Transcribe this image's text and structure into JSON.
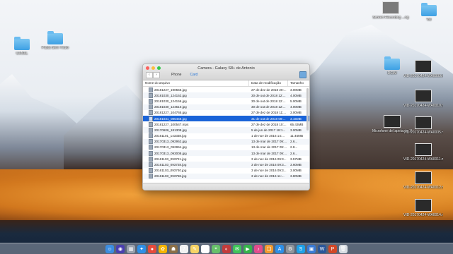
{
  "window": {
    "title": "Camera - Galaxy S8+ de Antonio",
    "nav_back": "‹",
    "nav_forward": "›",
    "tab_phone": "Phone",
    "tab_card": "Card",
    "columns": {
      "name": "Nome do arquivo",
      "date": "Data de modificação",
      "size": "Tamanho"
    },
    "rows": [
      {
        "name": "20181227_190556.jpg",
        "date": "27 de dez de 2018 20:...",
        "size": "3.00MB",
        "selected": false
      },
      {
        "name": "20181030_124152.jpg",
        "date": "30 de out de 2018 12:...",
        "size": "4.00MB",
        "selected": false
      },
      {
        "name": "20181030_124156.jpg",
        "date": "30 de out de 2018 12:...",
        "size": "5.00MB",
        "selected": false
      },
      {
        "name": "20181030_124510.jpg",
        "date": "30 de out de 2018 12:...",
        "size": "4.00MB",
        "selected": false
      },
      {
        "name": "20181227_104765.jpg",
        "date": "27 de dez de 2018 11:...",
        "size": "3.00MB",
        "selected": false
      },
      {
        "name": "20181031_085458.jpg",
        "date": "31 de out de 2018 09:...",
        "size": "3.15MB",
        "selected": true
      },
      {
        "name": "20181227_100547.mp4",
        "date": "27 de dez de 2018 10:...",
        "size": "65.43MB",
        "selected": false
      },
      {
        "name": "20170606_181308.jpg",
        "date": "5 de jun de 2017 18:1...",
        "size": "3.00MB",
        "selected": false
      },
      {
        "name": "20161101_143338.jpg",
        "date": "1 de nov de 2016 14:...",
        "size": "11.45MB",
        "selected": false
      },
      {
        "name": "20170313_092952.jpg",
        "date": "13 de mar de 2017 09:...",
        "size": "2.6...",
        "selected": false
      },
      {
        "name": "20170313_092954.jpg",
        "date": "13 de mar de 2017 09:...",
        "size": "2.8...",
        "selected": false
      },
      {
        "name": "20170313_093008.jpg",
        "date": "13 de mar de 2017 09:...",
        "size": "2.6...",
        "selected": false
      },
      {
        "name": "20161103_093721.jpg",
        "date": "3 de nov de 2016 09:3...",
        "size": "3.57MB",
        "selected": false
      },
      {
        "name": "20161103_093728.jpg",
        "date": "3 de nov de 2016 09:3...",
        "size": "3.60MB",
        "selected": false
      },
      {
        "name": "20161103_093740.jpg",
        "date": "3 de nov de 2016 09:3...",
        "size": "3.00MB",
        "selected": false
      },
      {
        "name": "20161103_093758.jpg",
        "date": "3 de nov de 2016 11:...",
        "size": "3.80MB",
        "selected": false
      }
    ]
  },
  "desktop_icons": [
    {
      "label": "CANAL",
      "kind": "folder"
    },
    {
      "label": "Pasta Sem Título",
      "kind": "folder"
    },
    {
      "label": "Screen Recording\n...ng",
      "kind": "thumb"
    },
    {
      "label": "Vai",
      "kind": "folder"
    },
    {
      "label": "DCIM",
      "kind": "folder"
    },
    {
      "label": "VID-20170424-WA0009.mp4",
      "kind": "thumb"
    },
    {
      "label": "VID-20170424-WA0010.mp4",
      "kind": "thumb"
    },
    {
      "label": "Microfone de lapela de 10 reais 2",
      "kind": "thumb"
    },
    {
      "label": "VID-20170424-WA0005.mp4",
      "kind": "thumb"
    },
    {
      "label": "VID-20170424-WA0011.mp4",
      "kind": "thumb"
    },
    {
      "label": "VID-20170424-WA0012.mp4",
      "kind": "thumb"
    },
    {
      "label": "VID-20170424-WA0014.mp4",
      "kind": "thumb"
    }
  ],
  "dock_apps": [
    {
      "name": "finder-icon",
      "color": "#3c8de0",
      "glyph": "☺"
    },
    {
      "name": "siri-icon",
      "color": "#4b3fb0",
      "glyph": "◉"
    },
    {
      "name": "launchpad-icon",
      "color": "#9aa1ad",
      "glyph": "▦"
    },
    {
      "name": "safari-icon",
      "color": "#2f8fe6",
      "glyph": "✦"
    },
    {
      "name": "chrome-icon",
      "color": "#e64a3b",
      "glyph": "●"
    },
    {
      "name": "photos-icon",
      "color": "#f4b400",
      "glyph": "✿"
    },
    {
      "name": "contacts-icon",
      "color": "#8b6f47",
      "glyph": "☗"
    },
    {
      "name": "calendar-icon",
      "color": "#f2f2f2",
      "glyph": "7"
    },
    {
      "name": "notes-icon",
      "color": "#f6d365",
      "glyph": "✎"
    },
    {
      "name": "reminders-icon",
      "color": "#ffffff",
      "glyph": "☰"
    },
    {
      "name": "maps-icon",
      "color": "#67c06a",
      "glyph": "⌖"
    },
    {
      "name": "photo-booth-icon",
      "color": "#c23b3b",
      "glyph": "◐"
    },
    {
      "name": "messages-icon",
      "color": "#3fc45a",
      "glyph": "✉"
    },
    {
      "name": "facetime-icon",
      "color": "#35b44a",
      "glyph": "▶"
    },
    {
      "name": "itunes-icon",
      "color": "#e24b8c",
      "glyph": "♪"
    },
    {
      "name": "ibooks-icon",
      "color": "#f29a2e",
      "glyph": "❏"
    },
    {
      "name": "app-store-icon",
      "color": "#2d8fe8",
      "glyph": "A"
    },
    {
      "name": "system-preferences-icon",
      "color": "#8f959c",
      "glyph": "⚙"
    },
    {
      "name": "skype-icon",
      "color": "#1fa1e8",
      "glyph": "S"
    },
    {
      "name": "iphoto-icon",
      "color": "#3a7bd5",
      "glyph": "▣"
    },
    {
      "name": "word-icon",
      "color": "#2b579a",
      "glyph": "W"
    },
    {
      "name": "powerpoint-icon",
      "color": "#d24726",
      "glyph": "P"
    },
    {
      "name": "trash-icon",
      "color": "#d8dde3",
      "glyph": "🗑"
    }
  ]
}
